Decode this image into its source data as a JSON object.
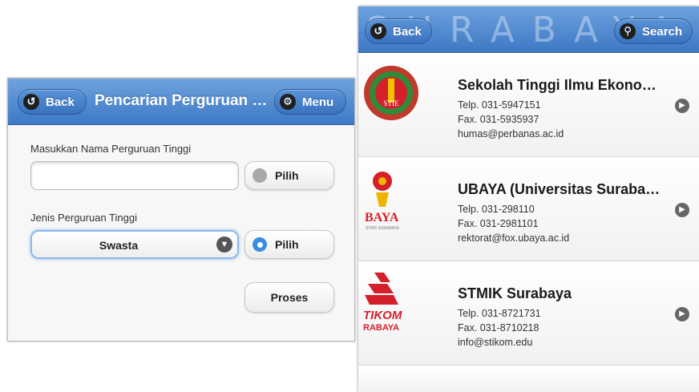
{
  "left": {
    "header": {
      "back_label": "Back",
      "title": "Pencarian Perguruan Tinggi",
      "menu_label": "Menu"
    },
    "form": {
      "name_label": "Masukkan Nama Perguruan Tinggi",
      "name_value": "",
      "pilih1_label": "Pilih",
      "jenis_label": "Jenis Perguruan Tinggi",
      "jenis_selected": "Swasta",
      "pilih2_label": "Pilih",
      "proses_label": "Proses"
    }
  },
  "right": {
    "watermark": "SURABAYA",
    "header": {
      "back_label": "Back",
      "search_label": "Search"
    },
    "items": [
      {
        "title": "Sekolah Tinggi Ilmu Ekonomi Perbanas",
        "phone": "Telp. 031-5947151",
        "fax": "Fax. 031-5935937",
        "email": "humas@perbanas.ac.id",
        "logo_text": "STIE"
      },
      {
        "title": "UBAYA (Universitas Surabaya)",
        "phone": "Telp. 031-298110",
        "fax": "Fax. 031-2981101",
        "email": "rektorat@fox.ubaya.ac.id",
        "logo_text": "BAYA",
        "logo_subtext": "SITAS SURABAYA"
      },
      {
        "title": "STMIK Surabaya",
        "phone": "Telp. 031-8721731",
        "fax": "Fax. 031-8710218",
        "email": "info@stikom.edu",
        "logo_text": "TIKOM",
        "logo_subtext": "RABAYA"
      }
    ]
  },
  "colors": {
    "header_blue": "#4a86cf",
    "radio_active": "#3a8ee0",
    "logo_red": "#d4202a"
  }
}
